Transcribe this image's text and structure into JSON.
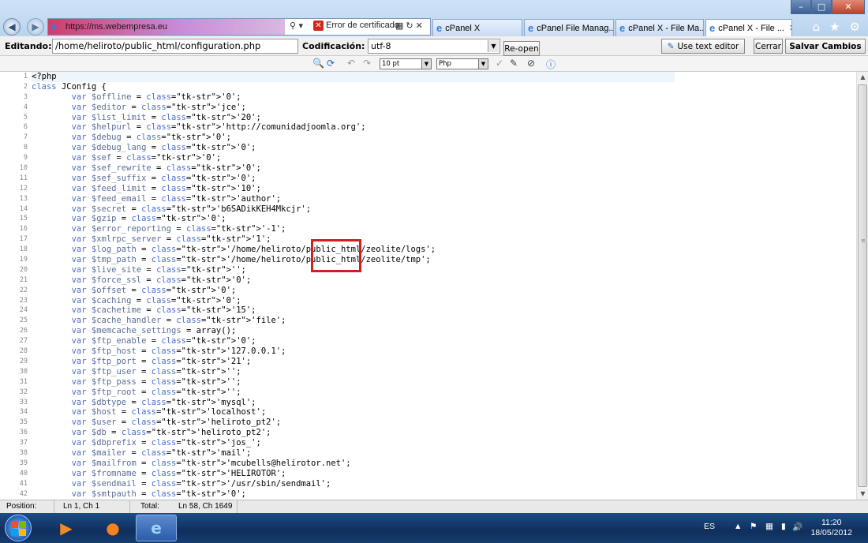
{
  "browser": {
    "address_url": "https://ms.webempresa.eu",
    "certificate_error": "Error de certificado",
    "tabs": [
      {
        "label": "cPanel X",
        "active": false
      },
      {
        "label": "cPanel File Manag...",
        "active": false
      },
      {
        "label": "cPanel X - File Ma...",
        "active": false
      },
      {
        "label": "cPanel X - File ...",
        "active": true
      }
    ]
  },
  "editor_toolbar": {
    "editing_label": "Editando:",
    "file_path": "/home/heliroto/public_html/configuration.php",
    "coding_label": "Codificación:",
    "encoding": "utf-8",
    "reopen_label": "Re-open",
    "text_editor_label": "Use text editor",
    "close_label": "Cerrar",
    "save_label": "Salvar Cambios"
  },
  "code_toolbar": {
    "font_size": "10 pt",
    "language": "Php"
  },
  "code": {
    "lines": [
      "<?php",
      "class JConfig {",
      "        var $offline = '0';",
      "        var $editor = 'jce';",
      "        var $list_limit = '20';",
      "        var $helpurl = 'http://comunidadjoomla.org';",
      "        var $debug = '0';",
      "        var $debug_lang = '0';",
      "        var $sef = '0';",
      "        var $sef_rewrite = '0';",
      "        var $sef_suffix = '0';",
      "        var $feed_limit = '10';",
      "        var $feed_email = 'author';",
      "        var $secret = 'b6SADikKEH4Mkcjr';",
      "        var $gzip = '0';",
      "        var $error_reporting = '-1';",
      "        var $xmlrpc_server = '1';",
      "        var $log_path = '/home/heliroto/public_html/zeolite/logs';",
      "        var $tmp_path = '/home/heliroto/public_html/zeolite/tmp';",
      "        var $live_site = '';",
      "        var $force_ssl = '0';",
      "        var $offset = '0';",
      "        var $caching = '0';",
      "        var $cachetime = '15';",
      "        var $cache_handler = 'file';",
      "        var $memcache_settings = array();",
      "        var $ftp_enable = '0';",
      "        var $ftp_host = '127.0.0.1';",
      "        var $ftp_port = '21';",
      "        var $ftp_user = '';",
      "        var $ftp_pass = '';",
      "        var $ftp_root = '';",
      "        var $dbtype = 'mysql';",
      "        var $host = 'localhost';",
      "        var $user = 'heliroto_pt2';",
      "        var $db = 'heliroto_pt2';",
      "        var $dbprefix = 'jos_';",
      "        var $mailer = 'mail';",
      "        var $mailfrom = 'mcubells@helirotor.net';",
      "        var $fromname = 'HELIROTOR';",
      "        var $sendmail = '/usr/sbin/sendmail';",
      "        var $smtpauth = '0';"
    ]
  },
  "status": {
    "position_label": "Position:",
    "position_value": "Ln 1, Ch 1",
    "total_label": "Total:",
    "total_value": "Ln 58, Ch 1649"
  },
  "taskbar": {
    "language": "ES",
    "time": "11:20",
    "date": "18/05/2012"
  }
}
